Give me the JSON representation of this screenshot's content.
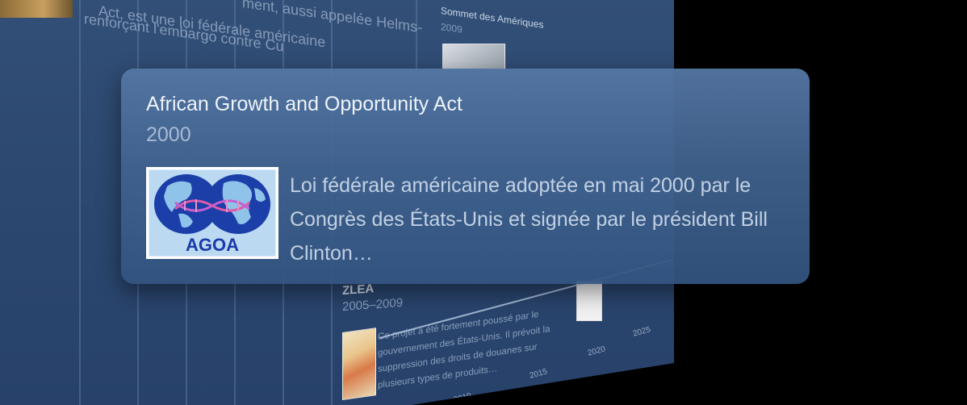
{
  "background": {
    "top_text_line1": "Act, est une loi fédérale américaine",
    "top_text_line2": "renforçant l'embargo contre Cu",
    "top_text_right": "ment, aussi appelée Helms-",
    "sommet": {
      "title": "Sommet des Amériques",
      "year": "2009"
    },
    "zlea": {
      "title": "ZLEA",
      "years": "2005–2009",
      "text": "Ce projet a été fortement poussé par le gouvernement des États-Unis. Il prévoit la suppression des droits de douanes sur plusieurs types de produits…"
    },
    "axis": {
      "labels": [
        "2010",
        "2015",
        "2020",
        "2025"
      ]
    },
    "colors": {
      "panel": "#2c4870",
      "background": "#000000"
    }
  },
  "card": {
    "title": "African Growth and Opportunity Act",
    "year": "2000",
    "image_icon": "agoa-logo-icon",
    "logo_text": "AGOA",
    "description": "Loi fédérale américaine adoptée en mai 2000 par le Congrès des États-Unis et signée par le président Bill Clinton…",
    "colors": {
      "card": "#4a6e9c",
      "title": "#eef3fa",
      "logo_blue": "#1a3aa8"
    }
  }
}
